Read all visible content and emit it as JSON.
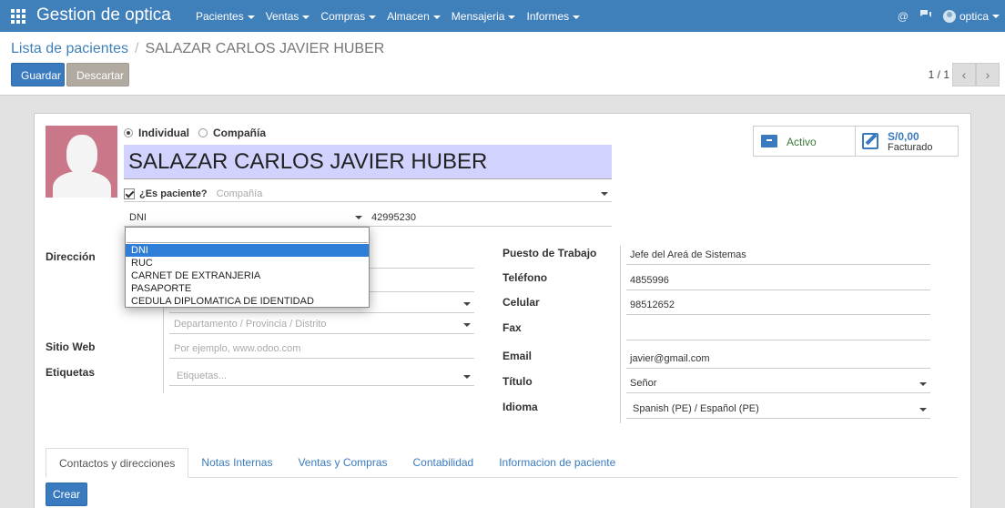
{
  "app": {
    "title": "Gestion de optica",
    "user": "optica"
  },
  "menu": [
    {
      "label": "Pacientes"
    },
    {
      "label": "Ventas"
    },
    {
      "label": "Compras"
    },
    {
      "label": "Almacen"
    },
    {
      "label": "Mensajeria"
    },
    {
      "label": "Informes"
    }
  ],
  "icons": {
    "apps": "apps-grid-icon",
    "mention": "at-icon",
    "chat": "chat-icon",
    "archive": "archive-icon",
    "invoice": "edit-icon"
  },
  "breadcrumb": {
    "parent": "Lista de pacientes",
    "separator": "/",
    "current": "SALAZAR CARLOS JAVIER HUBER"
  },
  "toolbar": {
    "save": "Guardar",
    "discard": "Descartar"
  },
  "pager": {
    "value": "1 / 1",
    "prev": "‹",
    "next": "›"
  },
  "form": {
    "type_options": {
      "individual": "Individual",
      "company": "Compañía"
    },
    "name": "SALAZAR CARLOS JAVIER HUBER",
    "is_patient_label": "¿Es paciente?",
    "company_placeholder": "Compañía",
    "doc_type": "DNI",
    "doc_number": "42995230",
    "doc_options": [
      "DNI",
      "RUC",
      "CARNET DE EXTRANJERIA",
      "PASAPORTE",
      "CEDULA DIPLOMATICA DE IDENTIDAD"
    ],
    "labels": {
      "address": "Dirección",
      "website": "Sitio Web",
      "tags": "Etiquetas",
      "job": "Puesto de Trabajo",
      "phone": "Teléfono",
      "mobile": "Celular",
      "fax": "Fax",
      "email": "Email",
      "title": "Título",
      "language": "Idioma"
    },
    "placeholders": {
      "region": "Departamento / Provincia / Distrito",
      "website": "Por ejemplo, www.odoo.com",
      "tags": "Etiquetas..."
    },
    "values": {
      "job": "Jefe del Areá  de Sistemas",
      "phone": "4855996",
      "mobile": "98512652",
      "fax": "",
      "email": "javier@gmail.com",
      "title": "Señor",
      "language": "Spanish (PE) / Español (PE)"
    }
  },
  "stat_buttons": {
    "active": "Activo",
    "invoiced_amount": "S/0,00",
    "invoiced_label": "Facturado"
  },
  "tabs": [
    "Contactos y direcciones",
    "Notas Internas",
    "Ventas y Compras",
    "Contabilidad",
    "Informacion de paciente"
  ],
  "actions": {
    "create": "Crear"
  }
}
